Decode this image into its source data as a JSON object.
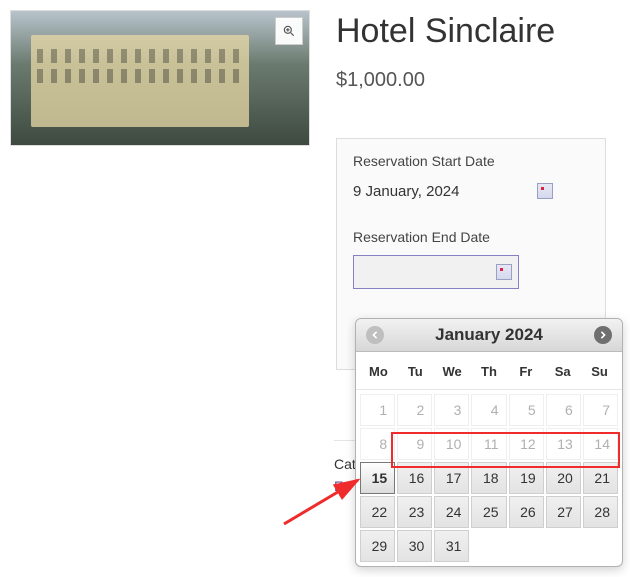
{
  "product": {
    "title": "Hotel Sinclaire",
    "price": "$1,000.00"
  },
  "form": {
    "start_label": "Reservation Start Date",
    "start_value": "9 January, 2024",
    "end_label": "Reservation End Date",
    "end_value": ""
  },
  "meta": {
    "cat_prefix": "Cat",
    "edit_prefix": "Ed"
  },
  "calendar": {
    "month_label": "January 2024",
    "dow": [
      "Mo",
      "Tu",
      "We",
      "Th",
      "Fr",
      "Sa",
      "Su"
    ],
    "weeks": [
      [
        {
          "d": "1",
          "state": "disabled"
        },
        {
          "d": "2",
          "state": "disabled"
        },
        {
          "d": "3",
          "state": "disabled"
        },
        {
          "d": "4",
          "state": "disabled"
        },
        {
          "d": "5",
          "state": "disabled"
        },
        {
          "d": "6",
          "state": "disabled"
        },
        {
          "d": "7",
          "state": "disabled"
        }
      ],
      [
        {
          "d": "8",
          "state": "disabled"
        },
        {
          "d": "9",
          "state": "disabled"
        },
        {
          "d": "10",
          "state": "disabled"
        },
        {
          "d": "11",
          "state": "disabled"
        },
        {
          "d": "12",
          "state": "disabled"
        },
        {
          "d": "13",
          "state": "disabled"
        },
        {
          "d": "14",
          "state": "disabled"
        }
      ],
      [
        {
          "d": "15",
          "state": "today"
        },
        {
          "d": "16",
          "state": "on"
        },
        {
          "d": "17",
          "state": "on"
        },
        {
          "d": "18",
          "state": "on"
        },
        {
          "d": "19",
          "state": "on"
        },
        {
          "d": "20",
          "state": "on"
        },
        {
          "d": "21",
          "state": "on"
        }
      ],
      [
        {
          "d": "22",
          "state": "on"
        },
        {
          "d": "23",
          "state": "on"
        },
        {
          "d": "24",
          "state": "on"
        },
        {
          "d": "25",
          "state": "on"
        },
        {
          "d": "26",
          "state": "on"
        },
        {
          "d": "27",
          "state": "on"
        },
        {
          "d": "28",
          "state": "on"
        }
      ],
      [
        {
          "d": "29",
          "state": "on"
        },
        {
          "d": "30",
          "state": "on"
        },
        {
          "d": "31",
          "state": "on"
        },
        {
          "d": "",
          "state": "blank"
        },
        {
          "d": "",
          "state": "blank"
        },
        {
          "d": "",
          "state": "blank"
        },
        {
          "d": "",
          "state": "blank"
        }
      ]
    ]
  },
  "annotation": {
    "red_box_days": [
      "9",
      "10",
      "11",
      "12",
      "13",
      "14"
    ]
  }
}
